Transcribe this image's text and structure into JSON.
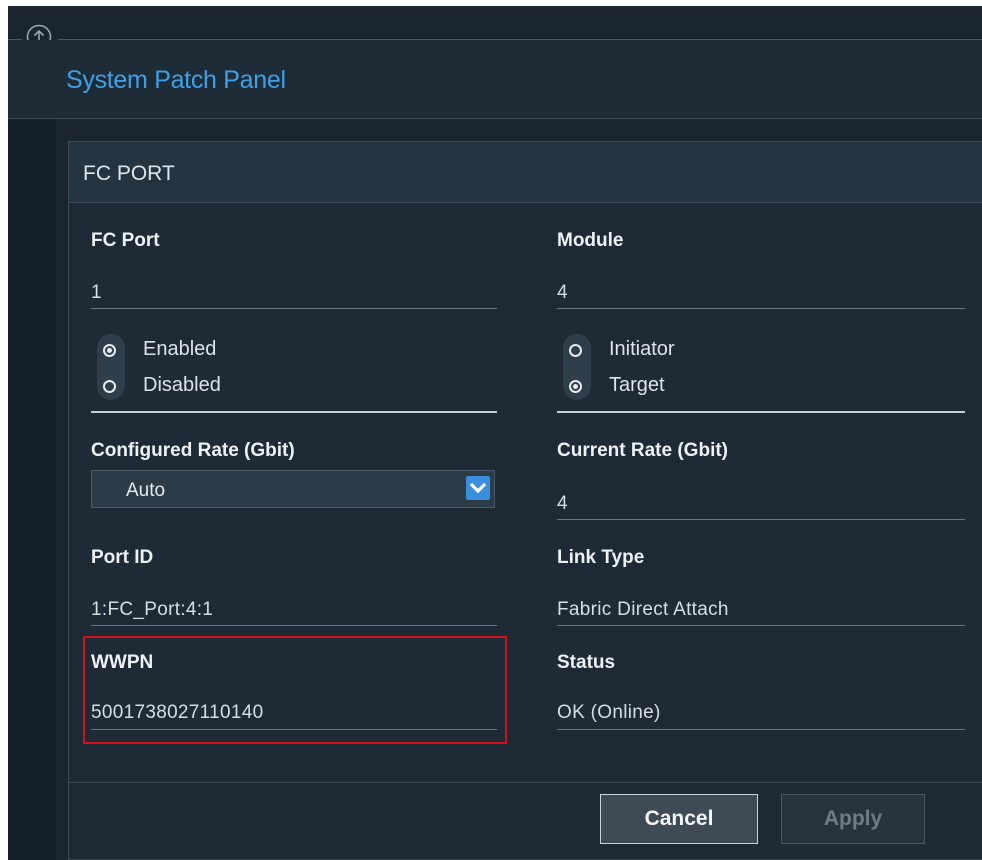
{
  "header": {
    "title": "System Patch Panel",
    "up_icon": "arrow-up-circle-icon"
  },
  "panel": {
    "title": "FC PORT",
    "fc_port": {
      "label": "FC Port",
      "value": "1"
    },
    "module": {
      "label": "Module",
      "value": "4"
    },
    "state": {
      "options": [
        {
          "label": "Enabled",
          "checked": true
        },
        {
          "label": "Disabled",
          "checked": false
        }
      ]
    },
    "role": {
      "options": [
        {
          "label": "Initiator",
          "checked": false
        },
        {
          "label": "Target",
          "checked": true
        }
      ]
    },
    "configured_rate": {
      "label": "Configured Rate (Gbit)",
      "value": "Auto",
      "arrow_icon": "chevron-down-icon"
    },
    "current_rate": {
      "label": "Current Rate (Gbit)",
      "value": "4"
    },
    "port_id": {
      "label": "Port ID",
      "value": "1:FC_Port:4:1"
    },
    "link_type": {
      "label": "Link Type",
      "value": "Fabric Direct Attach"
    },
    "wwpn": {
      "label": "WWPN",
      "value": "5001738027110140"
    },
    "status": {
      "label": "Status",
      "value": "OK (Online)"
    }
  },
  "buttons": {
    "cancel": "Cancel",
    "apply": "Apply"
  },
  "colors": {
    "accent": "#3fa0e6",
    "background": "#1a2530",
    "highlight": "#d4101a"
  }
}
